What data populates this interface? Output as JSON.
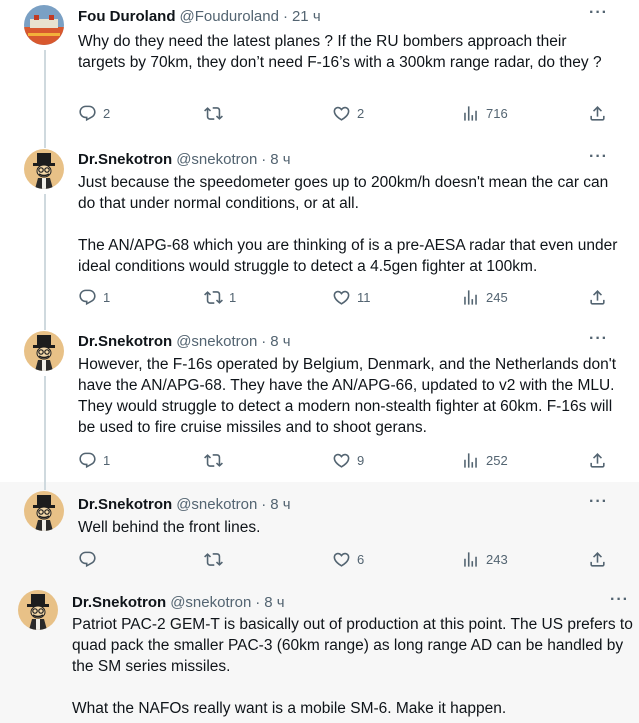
{
  "tweets": [
    {
      "name": "Fou Duroland",
      "handle": "@Fouduroland",
      "time": "21 ч",
      "paragraphs": [
        "Why do they need the latest planes ? If the RU bombers approach their targets by 70km, they don’t need F-16’s with a 300km range radar, do they ?"
      ],
      "replies": "2",
      "retweets": "",
      "likes": "2",
      "views": "716"
    },
    {
      "name": "Dr.Snekotron",
      "handle": "@snekotron",
      "time": "8 ч",
      "paragraphs": [
        "Just because the speedometer goes up to 200km/h doesn't mean the car can do that under normal conditions, or at all.",
        "The AN/APG-68 which you are thinking of is a pre-AESA radar that even under ideal conditions would struggle to detect a 4.5gen fighter at 100km."
      ],
      "replies": "1",
      "retweets": "1",
      "likes": "11",
      "views": "245"
    },
    {
      "name": "Dr.Snekotron",
      "handle": "@snekotron",
      "time": "8 ч",
      "paragraphs": [
        "However, the F-16s operated by Belgium, Denmark, and the Netherlands don't have the AN/APG-68. They have the AN/APG-66, updated to v2 with the MLU. They would struggle to detect a modern non-stealth fighter at 60km. F-16s will be used to fire cruise missiles and to shoot gerans."
      ],
      "replies": "1",
      "retweets": "",
      "likes": "9",
      "views": "252"
    },
    {
      "name": "Dr.Snekotron",
      "handle": "@snekotron",
      "time": "8 ч",
      "paragraphs": [
        "Well behind the front lines."
      ],
      "replies": "",
      "retweets": "",
      "likes": "6",
      "views": "243"
    },
    {
      "name": "Dr.Snekotron",
      "handle": "@snekotron",
      "time": "8 ч",
      "paragraphs": [
        "Patriot PAC-2 GEM-T is basically out of production at this point. The US prefers to quad pack the smaller PAC-3 (60km range) as long range AD can be handled by the SM series missiles.",
        "What the NAFOs really want is a mobile SM-6. Make it happen."
      ]
    }
  ],
  "icons": {
    "reply": "reply-icon",
    "retweet": "retweet-icon",
    "like": "heart-icon",
    "views": "views-icon",
    "share": "share-icon",
    "more": "more-icon"
  },
  "colors": {
    "text": "#0f1419",
    "secondary": "#536471",
    "thread_line": "#cfd9de",
    "highlight_bg": "#f7f7f7"
  }
}
